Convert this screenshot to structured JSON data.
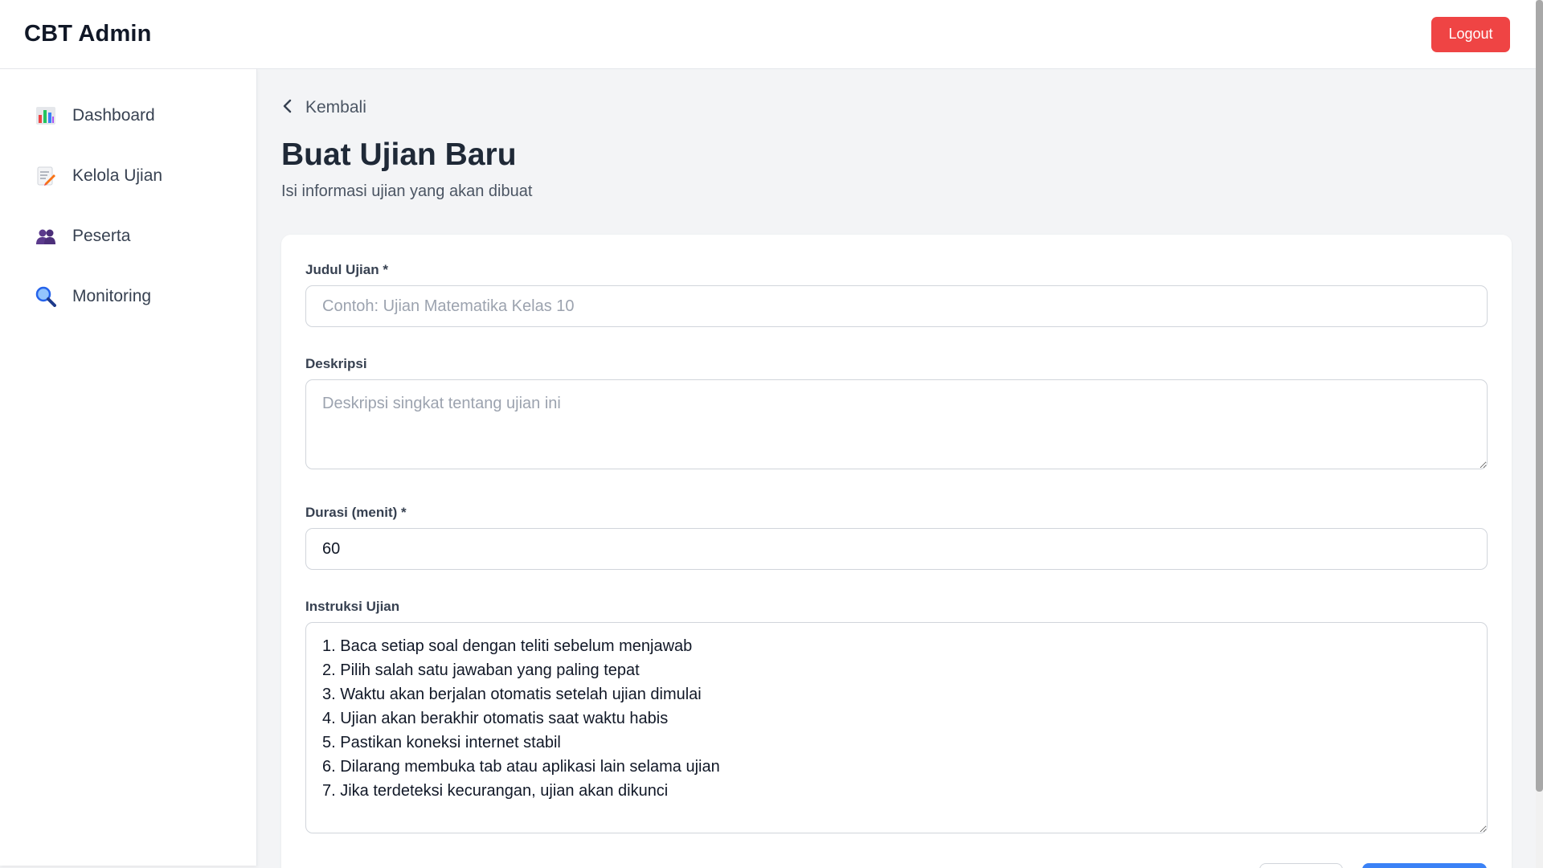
{
  "app": {
    "title": "CBT Admin",
    "logout_label": "Logout"
  },
  "sidebar": {
    "items": [
      {
        "label": "Dashboard",
        "icon": "bar-chart-icon"
      },
      {
        "label": "Kelola Ujian",
        "icon": "memo-icon"
      },
      {
        "label": "Peserta",
        "icon": "people-icon"
      },
      {
        "label": "Monitoring",
        "icon": "magnifier-icon"
      }
    ]
  },
  "page": {
    "back_label": "Kembali",
    "title": "Buat Ujian Baru",
    "subtitle": "Isi informasi ujian yang akan dibuat"
  },
  "form": {
    "title_label": "Judul Ujian *",
    "title_placeholder": "Contoh: Ujian Matematika Kelas 10",
    "title_value": "",
    "description_label": "Deskripsi",
    "description_placeholder": "Deskripsi singkat tentang ujian ini",
    "duration_label": "Durasi (menit) *",
    "duration_value": "60",
    "instructions_label": "Instruksi Ujian",
    "instructions_value": "1. Baca setiap soal dengan teliti sebelum menjawab\n2. Pilih salah satu jawaban yang paling tepat\n3. Waktu akan berjalan otomatis setelah ujian dimulai\n4. Ujian akan berakhir otomatis saat waktu habis\n5. Pastikan koneksi internet stabil\n6. Dilarang membuka tab atau aplikasi lain selama ujian\n7. Jika terdeteksi kecurangan, ujian akan dikunci"
  },
  "colors": {
    "danger": "#ef4444",
    "primary": "#3b82f6",
    "background": "#f3f4f6"
  }
}
